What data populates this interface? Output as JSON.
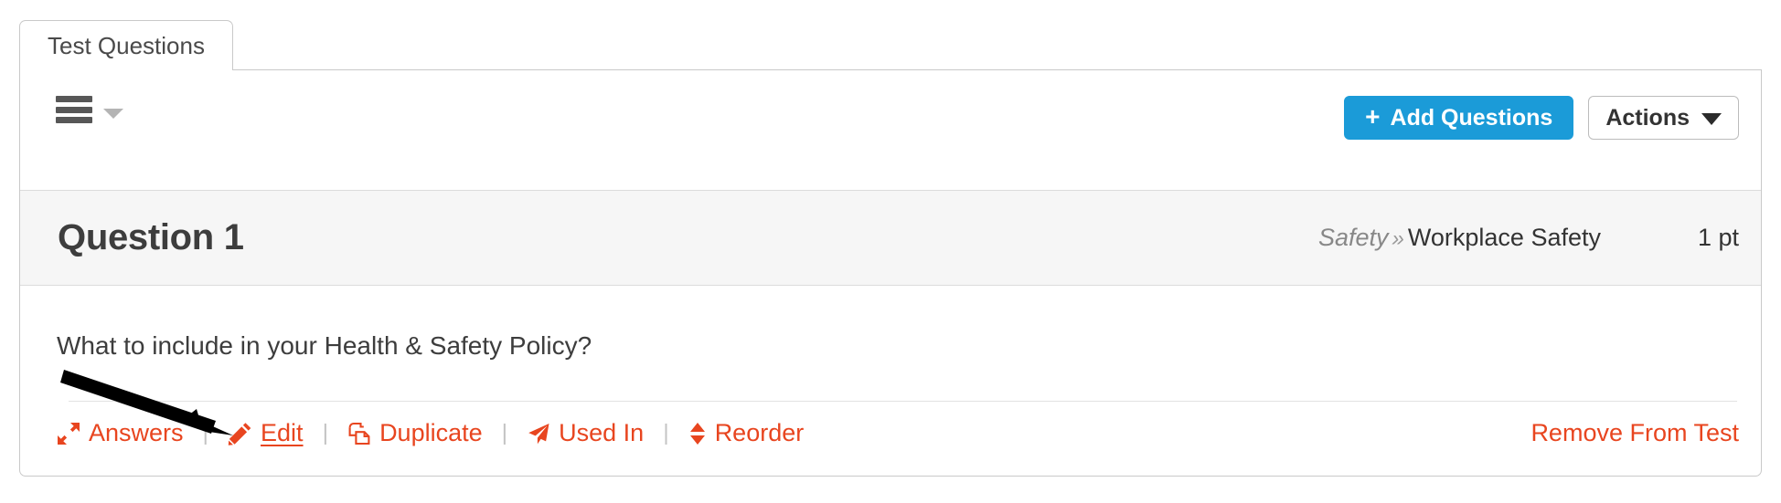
{
  "tabs": [
    {
      "label": "Test Questions",
      "active": true
    }
  ],
  "toolbar": {
    "menu_icon": "hamburger-menu-icon",
    "menu_caret_icon": "caret-down-icon",
    "add_questions_label": "Add Questions",
    "add_questions_plus": "+",
    "actions_label": "Actions",
    "actions_caret_icon": "caret-down-icon",
    "primary_color": "#1b9bd8"
  },
  "question": {
    "title": "Question 1",
    "category": "Safety",
    "category_separator": "»",
    "subcategory": "Workplace Safety",
    "points": "1 pt",
    "text": "What to include in your Health & Safety Policy?",
    "link_color": "#e8451f",
    "actions": [
      {
        "label": "Answers",
        "icon": "expand-arrows-icon",
        "hovered": false
      },
      {
        "label": "Edit",
        "icon": "pencil-icon",
        "hovered": true
      },
      {
        "label": "Duplicate",
        "icon": "copy-icon",
        "hovered": false
      },
      {
        "label": "Used In",
        "icon": "paper-plane-icon",
        "hovered": false
      },
      {
        "label": "Reorder",
        "icon": "sort-up-down-icon",
        "hovered": false
      }
    ],
    "action_divider": "|",
    "remove_label": "Remove From Test"
  },
  "annotation": {
    "arrow_color": "#000000",
    "points_to": "Edit"
  }
}
